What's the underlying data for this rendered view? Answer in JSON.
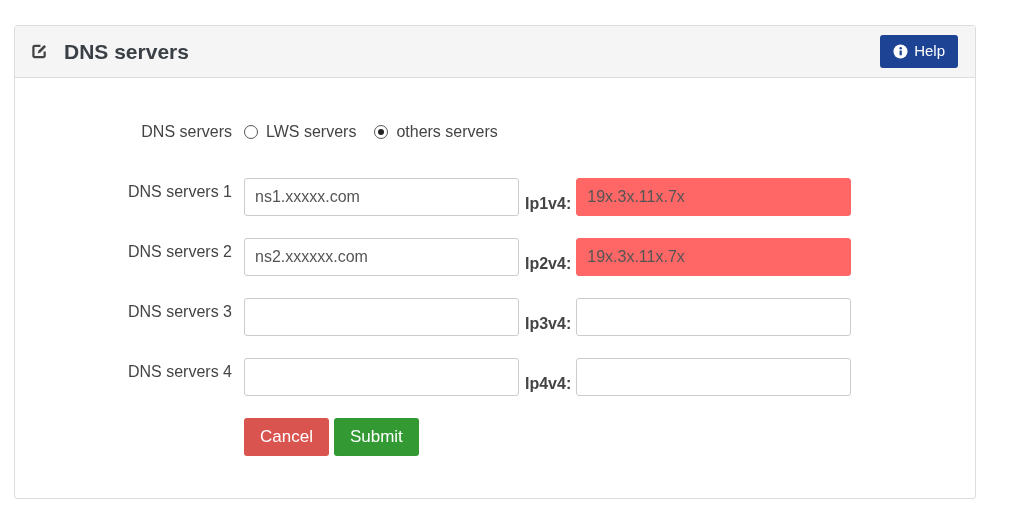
{
  "panel": {
    "title": "DNS servers",
    "help_button": "Help"
  },
  "mode": {
    "label": "DNS servers",
    "options": [
      {
        "label": "LWS servers",
        "selected": false
      },
      {
        "label": "others servers",
        "selected": true
      }
    ]
  },
  "servers": [
    {
      "label": "DNS servers 1",
      "value": "ns1.xxxxx.com",
      "ip_label": "Ip1v4:",
      "ip_value": "19x.3x.11x.7x",
      "error": true
    },
    {
      "label": "DNS servers 2",
      "value": "ns2.xxxxxx.com",
      "ip_label": "Ip2v4:",
      "ip_value": "19x.3x.11x.7x",
      "error": true
    },
    {
      "label": "DNS servers 3",
      "ip_label": "Ip3v4:",
      "error": false
    },
    {
      "label": "DNS servers 4",
      "ip_label": "Ip4v4:",
      "error": false
    }
  ],
  "buttons": [
    {
      "label": "Cancel",
      "kind": "cancel"
    },
    {
      "label": "Submit",
      "kind": "submit"
    }
  ]
}
